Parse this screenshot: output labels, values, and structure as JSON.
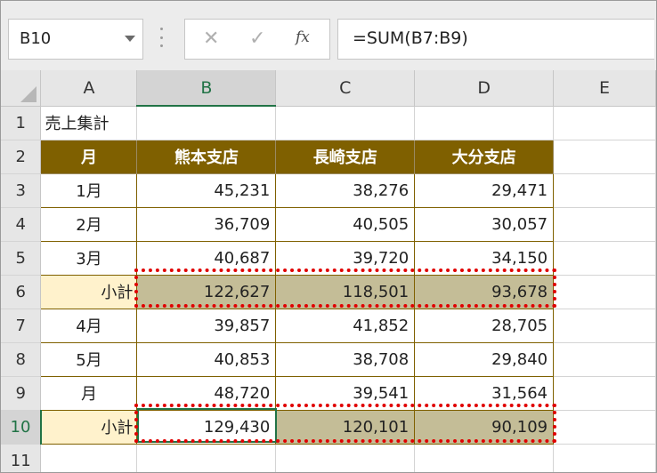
{
  "name_box": {
    "value": "B10"
  },
  "formula_bar": {
    "cancel_glyph": "✕",
    "enter_glyph": "✓",
    "function_label": "fx",
    "formula": "=SUM(B7:B9)"
  },
  "columns": [
    "A",
    "B",
    "C",
    "D",
    "E"
  ],
  "selected_cell": {
    "column": "B",
    "row": "10"
  },
  "rows": [
    {
      "num": "1",
      "cells": [
        "売上集計",
        "",
        "",
        "",
        ""
      ]
    },
    {
      "num": "2",
      "cells": [
        "月",
        "熊本支店",
        "長崎支店",
        "大分支店",
        ""
      ]
    },
    {
      "num": "3",
      "cells": [
        "1月",
        "45,231",
        "38,276",
        "29,471",
        ""
      ]
    },
    {
      "num": "4",
      "cells": [
        "2月",
        "36,709",
        "40,505",
        "30,057",
        ""
      ]
    },
    {
      "num": "5",
      "cells": [
        "3月",
        "40,687",
        "39,720",
        "34,150",
        ""
      ]
    },
    {
      "num": "6",
      "cells": [
        "小計",
        "122,627",
        "118,501",
        "93,678",
        ""
      ]
    },
    {
      "num": "7",
      "cells": [
        "4月",
        "39,857",
        "41,852",
        "28,705",
        ""
      ]
    },
    {
      "num": "8",
      "cells": [
        "5月",
        "40,853",
        "38,708",
        "29,840",
        ""
      ]
    },
    {
      "num": "9",
      "cells": [
        "月",
        "48,720",
        "39,541",
        "31,564",
        ""
      ]
    },
    {
      "num": "10",
      "cells": [
        "小計",
        "129,430",
        "120,101",
        "90,109",
        ""
      ]
    },
    {
      "num": "11",
      "cells": [
        "",
        "",
        "",
        "",
        ""
      ]
    }
  ],
  "colors": {
    "table_header_fill": "#7f6000",
    "subtotal_label_fill": "#fff2cc",
    "subtotal_value_fill": "#c4bd97",
    "highlight_border": "#e00000",
    "selection": "#217346"
  }
}
